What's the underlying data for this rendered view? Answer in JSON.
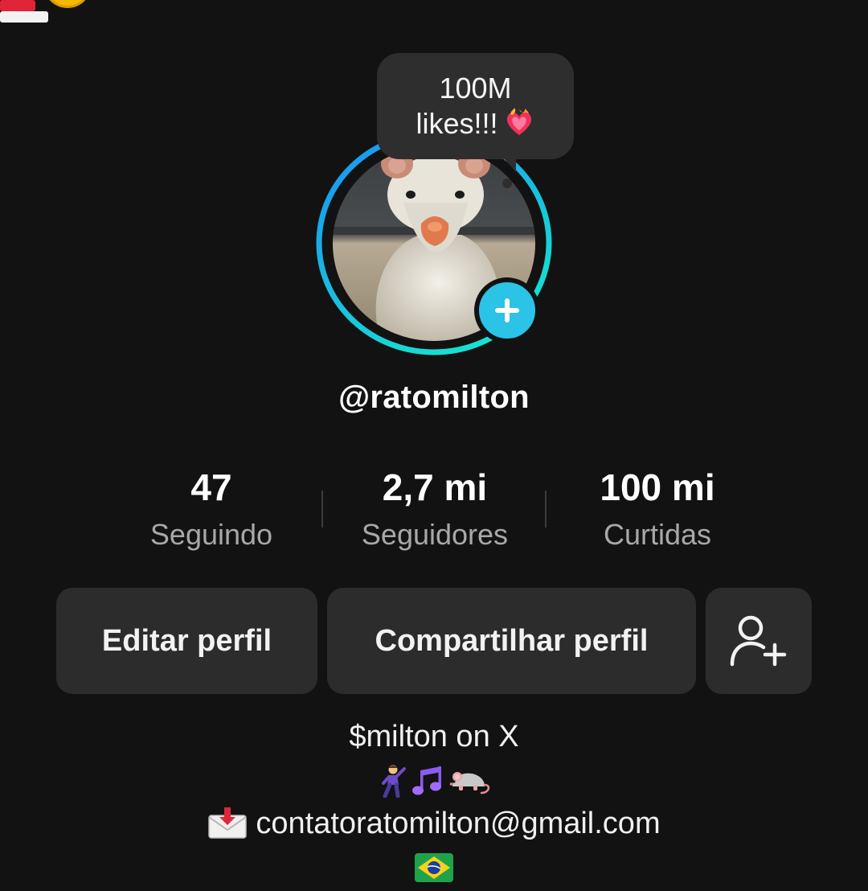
{
  "note": {
    "line1": "100M",
    "line2": "likes!!!"
  },
  "profile": {
    "username": "@ratomilton"
  },
  "stats": [
    {
      "value": "47",
      "label": "Seguindo"
    },
    {
      "value": "2,7 mi",
      "label": "Seguidores"
    },
    {
      "value": "100 mi",
      "label": "Curtidas"
    }
  ],
  "actions": {
    "edit_label": "Editar perfil",
    "share_label": "Compartilhar perfil",
    "add_friend_icon": "add-user-icon"
  },
  "bio": {
    "line1": "$milton on X",
    "emojis": [
      "man-dancing",
      "musical-notes",
      "mouse"
    ],
    "email": "contatoratomilton@gmail.com",
    "email_icon": "envelope-with-arrow",
    "flag": "brazil-flag"
  },
  "colors": {
    "background": "#121212",
    "button_bg": "#2c2c2c",
    "accent": "#2bc3e6",
    "ring_start": "#1aa0f5",
    "ring_end": "#17e0d0",
    "secondary_text": "#a8a8a8"
  }
}
